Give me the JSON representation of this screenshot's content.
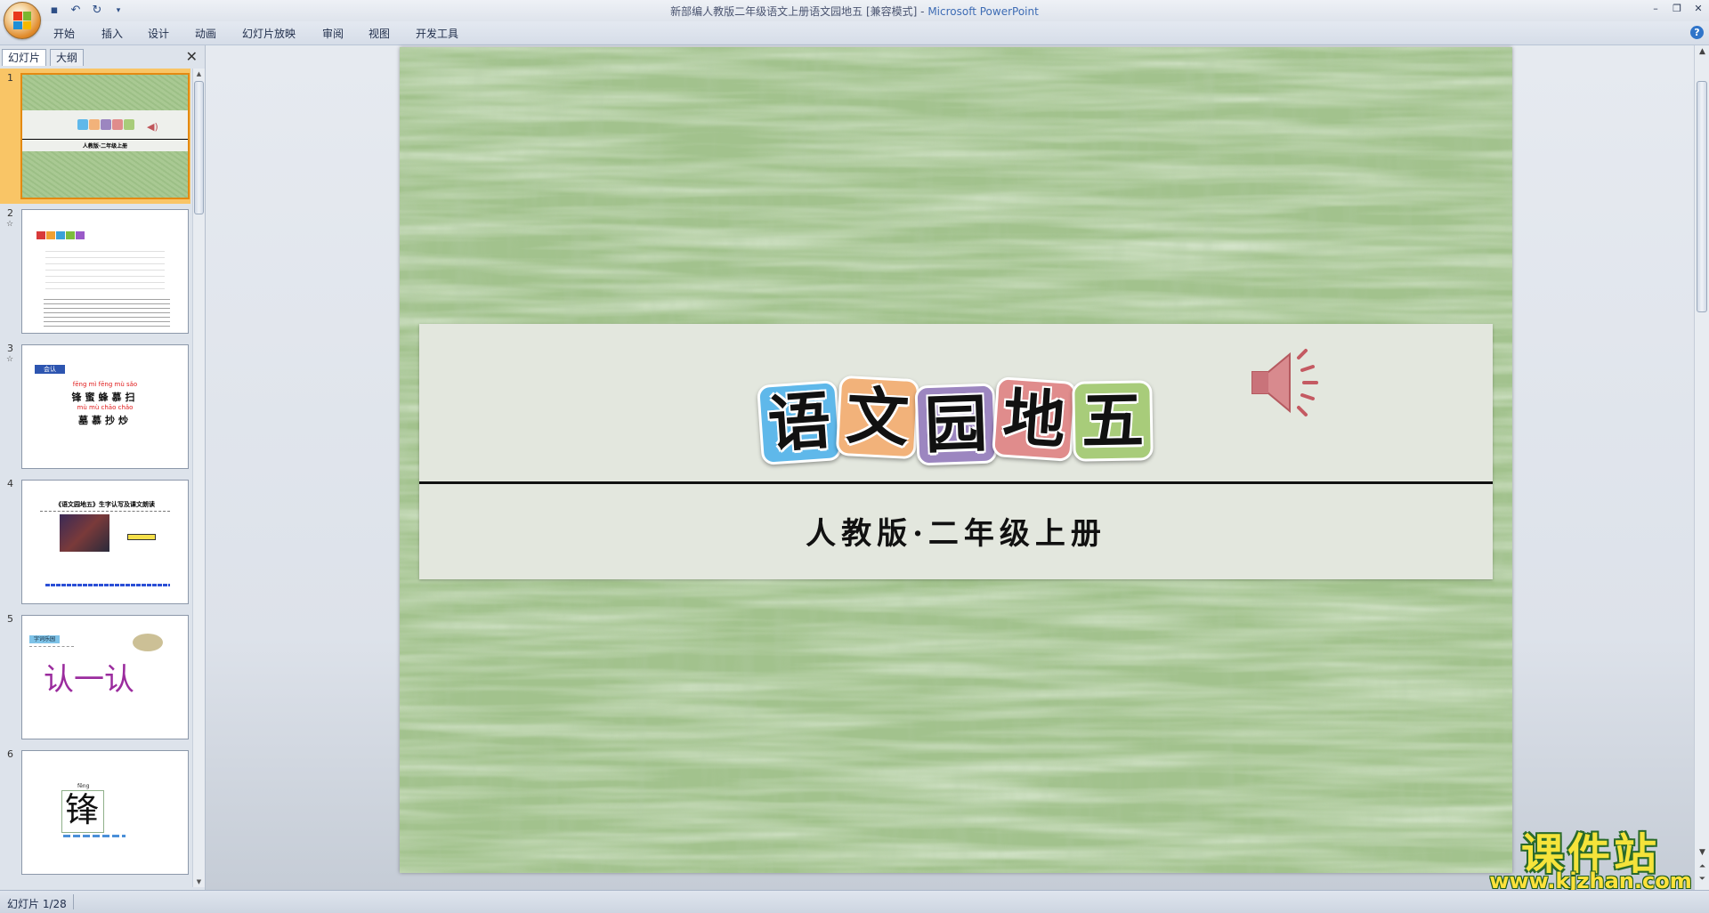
{
  "window": {
    "title": "新部编人教版二年级语文上册语文园地五 [兼容模式]",
    "separator": " - ",
    "app_name": "Microsoft PowerPoint"
  },
  "ribbon": {
    "tabs": [
      "开始",
      "插入",
      "设计",
      "动画",
      "幻灯片放映",
      "审阅",
      "视图",
      "开发工具"
    ]
  },
  "panel": {
    "tabs": [
      "幻灯片",
      "大纲"
    ],
    "slides": [
      {
        "num": "1",
        "selected": true
      },
      {
        "num": "2",
        "selected": false,
        "header_tiles": [
          "#d83a3a",
          "#f0a032",
          "#3aa0d8",
          "#7cbc3c",
          "#9a5ac8"
        ]
      },
      {
        "num": "3",
        "selected": false,
        "tag": "会认",
        "pinyin1": "fēng   mì   fēng   mù   sǎo",
        "hanzi1": "锋蜜蜂慕扫",
        "pinyin2": "mù   mù   chāo  chǎo",
        "hanzi2": "墓慕抄炒"
      },
      {
        "num": "4",
        "selected": false,
        "title": "《语文园地五》生字认写及课文朗读"
      },
      {
        "num": "5",
        "selected": false,
        "tag": "字词乐园",
        "text": "认一认"
      },
      {
        "num": "6",
        "selected": false,
        "pinyin": "fēng",
        "char": "锋"
      }
    ]
  },
  "slide": {
    "title_chars": [
      {
        "char": "语",
        "color": "#5fb8ea"
      },
      {
        "char": "文",
        "color": "#f2b27a"
      },
      {
        "char": "园",
        "color": "#9c86c0"
      },
      {
        "char": "地",
        "color": "#e08c8c"
      },
      {
        "char": "五",
        "color": "#a8cc7a"
      }
    ],
    "subtitle": "人教版·二年级上册",
    "background_color": "#a2c28d",
    "band_color": "#e3e7de"
  },
  "watermark": {
    "main": "课件站",
    "url": "www.kjzhan.com"
  },
  "status": {
    "slide_indicator": "幻灯片 1/28"
  }
}
